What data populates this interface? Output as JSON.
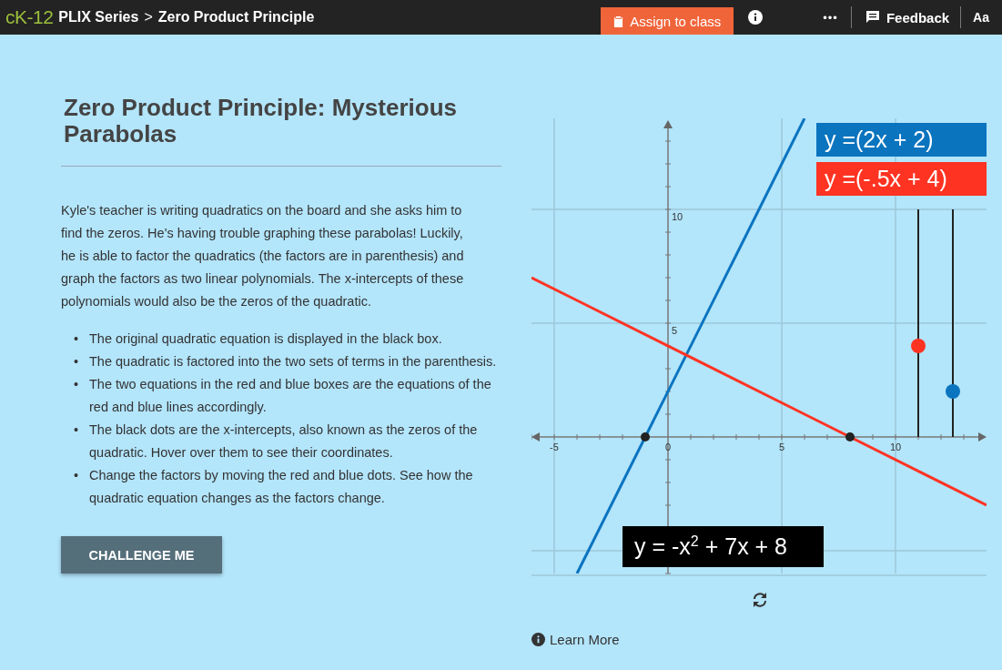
{
  "header": {
    "logo": "cK-12",
    "series": "PLIX Series",
    "separator": ">",
    "title": "Zero Product Principle",
    "assign_button": "Assign to class",
    "more": "•••",
    "feedback": "Feedback",
    "font_button": "Aa"
  },
  "title": "Zero Product Principle: Mysterious Parabolas",
  "intro": "Kyle's teacher is writing quadratics on the board and she asks him to find the zeros. He's having trouble graphing these parabolas! Luckily, he is able to factor the quadratics (the factors are in parenthesis) and graph the factors as two linear polynomials. The x-intercepts of these polynomials would also be the zeros of the quadratic.",
  "bullets": [
    {
      "marker": "•",
      "text": "The original quadratic equation is displayed in the black box."
    },
    {
      "marker": "•",
      "text": "The quadratic is factored into the two sets of terms in the parenthesis."
    },
    {
      "marker": "•",
      "text": "The two equations in the red and blue boxes are the equations of the red and blue lines accordingly."
    },
    {
      "marker": "•",
      "text": "The black dots are the x-intercepts, also known as the zeros of the quadratic. Hover over them to see their coordinates."
    },
    {
      "marker": "•",
      "text": "Change the factors by moving the red and blue dots. See how the quadratic equation changes as the factors change."
    }
  ],
  "challenge_button": "CHALLENGE ME",
  "graph": {
    "chart_data": {
      "type": "line",
      "x": [
        -6,
        -4,
        6,
        14
      ],
      "series": [
        {
          "name": "y =(2x + 2)",
          "color": "#0a74bf",
          "values": [
            null,
            -6,
            14,
            null
          ]
        },
        {
          "name": "y =(-.5x + 4)",
          "color": "#ff3322",
          "values": [
            7,
            6,
            1,
            -3
          ]
        }
      ],
      "xlim": [
        -6,
        14
      ],
      "ylim": [
        -6,
        14
      ],
      "xticks": [
        -5,
        0,
        5,
        10
      ],
      "yticks": [
        5,
        10
      ],
      "grid": true
    },
    "sliders": [
      {
        "level": 0.4,
        "color": "#ff3322"
      },
      {
        "level": 0.2,
        "color": "#0a74bf"
      }
    ],
    "quadratic": "y = -x$^{2}$ + 7x + 8"
  },
  "learn_more": "Learn More"
}
